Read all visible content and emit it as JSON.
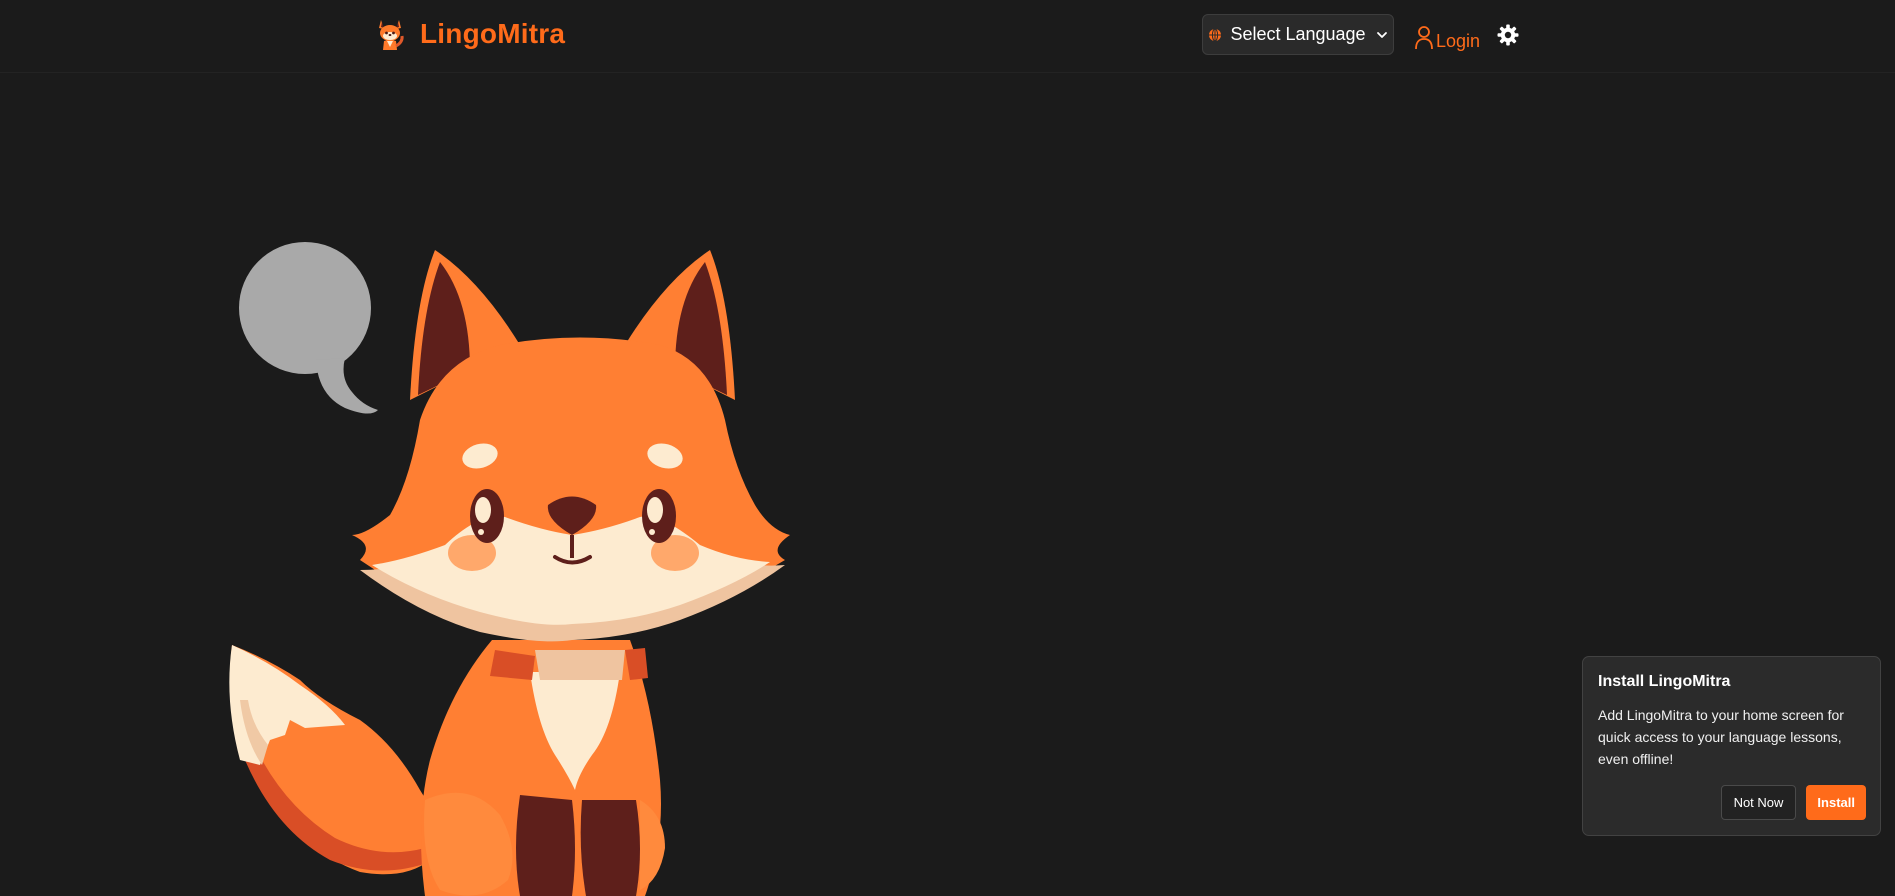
{
  "app": {
    "name": "LingoMitra",
    "brand_color": "#ff6b1a",
    "background_color": "#1b1b1b"
  },
  "header": {
    "logo_icon": "fox-logo-icon",
    "language_select": {
      "label": "Select Language",
      "icon": "globe-icon",
      "caret": "chevron-down-icon"
    },
    "login": {
      "label": "Login",
      "icon": "user-icon"
    },
    "settings_icon": "gear-icon"
  },
  "hero": {
    "illustration": "fox-mascot-with-speech-bubble",
    "speech_bubble_color": "#a9a9a9"
  },
  "install_prompt": {
    "title": "Install LingoMitra",
    "body": "Add LingoMitra to your home screen for quick access to your language lessons, even offline!",
    "dismiss_label": "Not Now",
    "install_label": "Install"
  }
}
